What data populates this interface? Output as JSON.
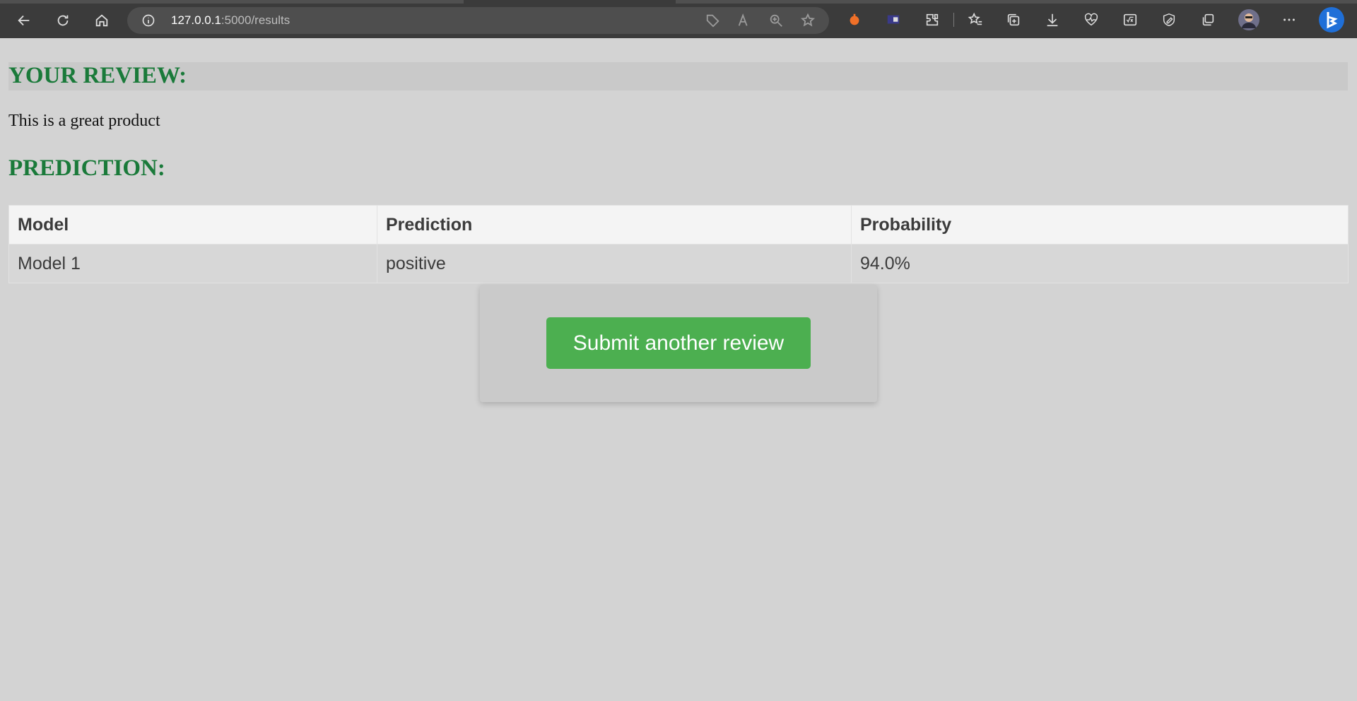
{
  "browser": {
    "url_host": "127.0.0.1",
    "url_path": ":5000/results"
  },
  "review": {
    "heading": "YOUR REVIEW:",
    "text": "This is a great product"
  },
  "prediction": {
    "heading": "PREDICTION:",
    "columns": [
      "Model",
      "Prediction",
      "Probability"
    ],
    "rows": [
      {
        "model": "Model 1",
        "prediction": "positive",
        "probability": "94.0%"
      }
    ]
  },
  "actions": {
    "submit_label": "Submit another review"
  },
  "colors": {
    "heading": "#1a7a3a",
    "button": "#4caf50",
    "page_bg": "#d3d3d3"
  }
}
